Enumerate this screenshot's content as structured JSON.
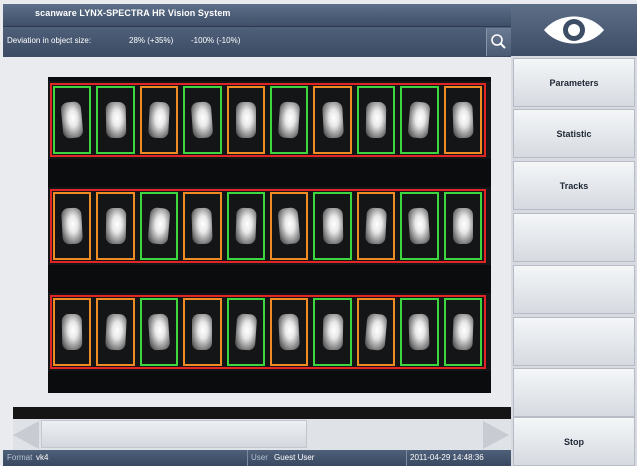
{
  "app": {
    "title": "scanware LYNX-SPECTRA HR Vision System"
  },
  "infobar": {
    "label": "Deviation in object size:",
    "value1": "28% (+35%)",
    "value2": "-100% (-10%)",
    "search_icon": "search-icon"
  },
  "colors": {
    "ok": "#3ed63e",
    "warn": "#f08c24",
    "frame": "#e22626"
  },
  "grid": {
    "rows": [
      [
        "green",
        "green",
        "orange",
        "green",
        "orange",
        "green",
        "orange",
        "green",
        "green",
        "orange"
      ],
      [
        "orange",
        "orange",
        "green",
        "orange",
        "green",
        "orange",
        "green",
        "orange",
        "green",
        "green"
      ],
      [
        "orange",
        "orange",
        "green",
        "orange",
        "green",
        "orange",
        "green",
        "orange",
        "green",
        "green"
      ]
    ]
  },
  "sidebar": {
    "logo_icon": "eye-icon",
    "buttons": [
      {
        "label": "Parameters"
      },
      {
        "label": "Statistic"
      },
      {
        "label": "Tracks"
      },
      {
        "label": ""
      },
      {
        "label": ""
      },
      {
        "label": ""
      },
      {
        "label": ""
      },
      {
        "label": "Stop"
      }
    ]
  },
  "statusbar": {
    "format_label": "Format",
    "format_value": "vk4",
    "user_label": "User",
    "user_value": "Guest User",
    "timestamp": "2011-04-29 14:48:36"
  }
}
